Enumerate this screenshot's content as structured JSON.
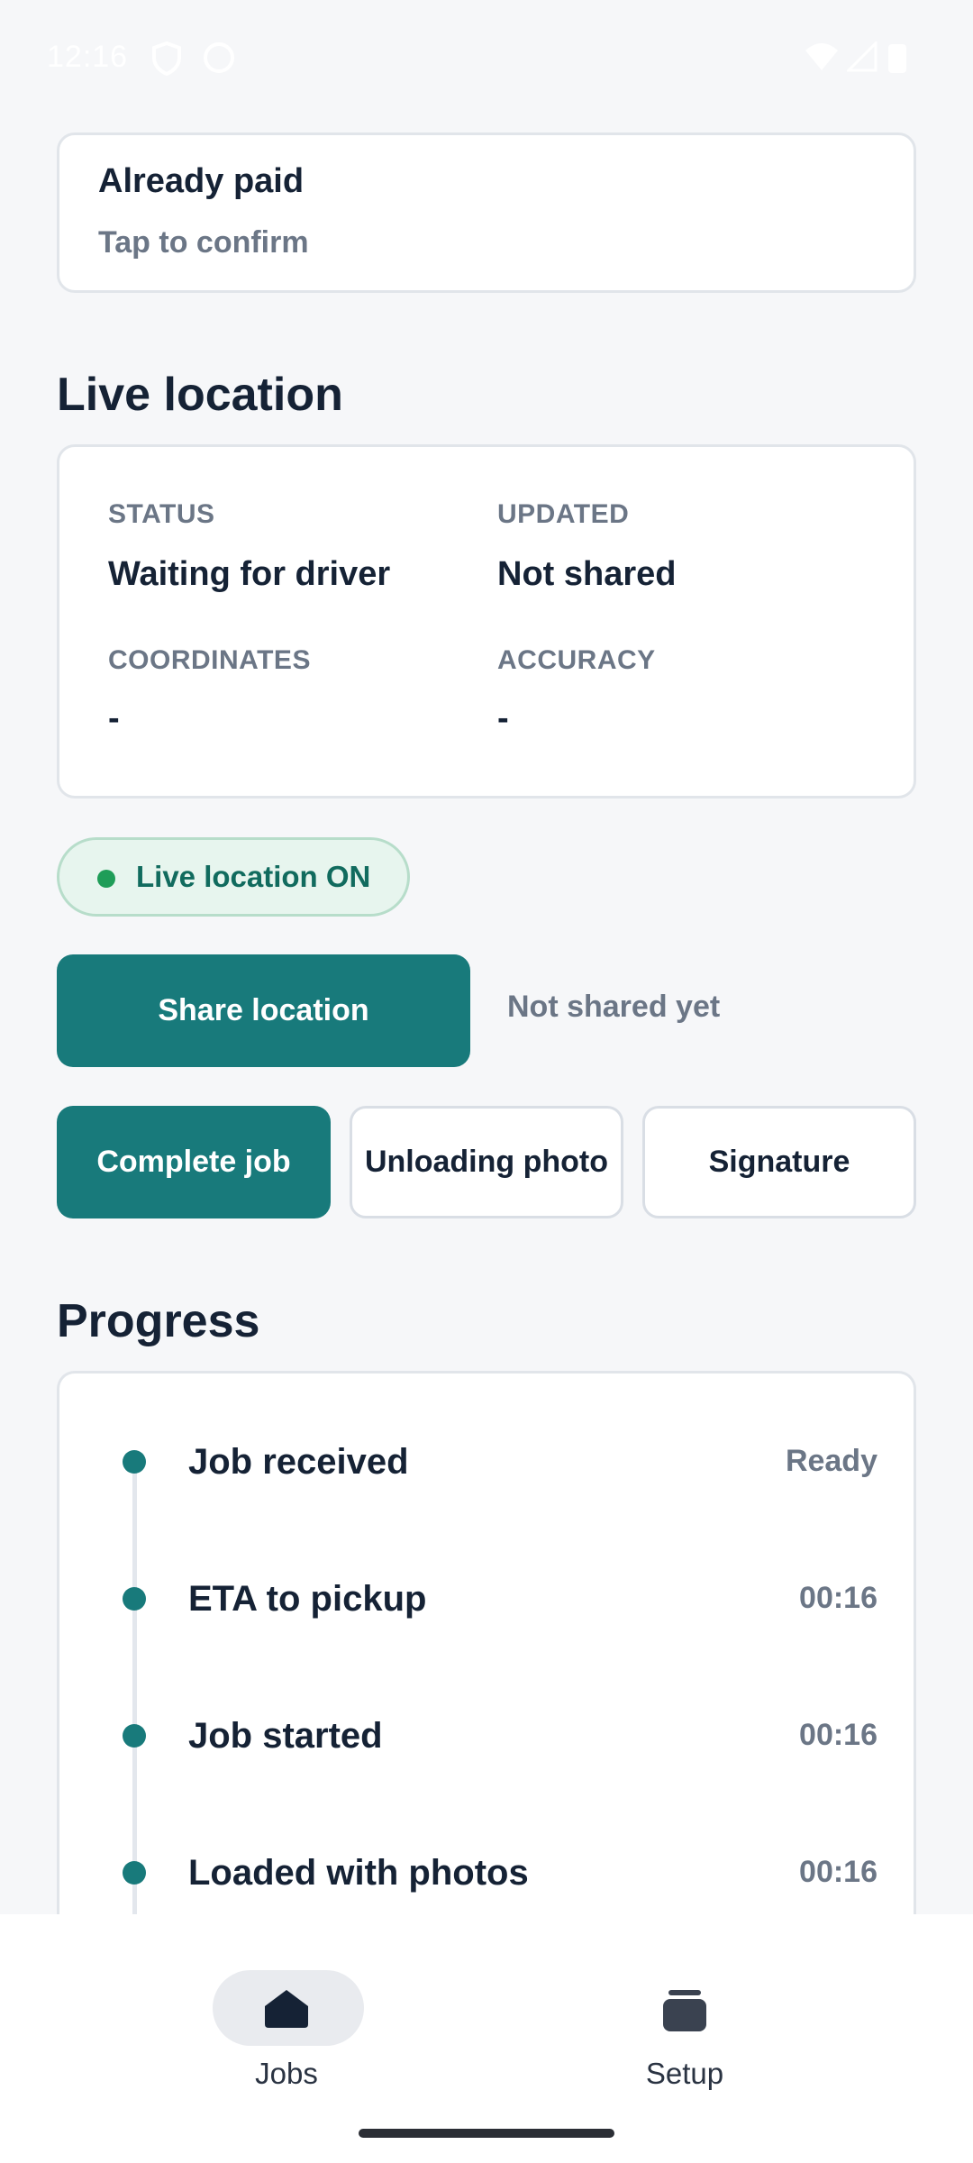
{
  "status_bar": {
    "time": "12:16"
  },
  "payment": {
    "title": "Already paid",
    "subtitle": "Tap to confirm"
  },
  "live_location": {
    "heading": "Live location",
    "status_label": "STATUS",
    "status_value": "Waiting for driver",
    "updated_label": "UPDATED",
    "updated_value": "Not shared",
    "coordinates_label": "COORDINATES",
    "coordinates_value": "-",
    "accuracy_label": "ACCURACY",
    "accuracy_value": "-",
    "pill_label": "Live location ON",
    "share_button": "Share location",
    "share_note": "Not shared yet"
  },
  "actions": {
    "complete": "Complete job",
    "unloading_photo": "Unloading photo",
    "signature": "Signature"
  },
  "progress": {
    "heading": "Progress",
    "steps": [
      {
        "label": "Job received",
        "meta": "Ready"
      },
      {
        "label": "ETA to pickup",
        "meta": "00:16"
      },
      {
        "label": "Job started",
        "meta": "00:16"
      },
      {
        "label": "Loaded with photos",
        "meta": "00:16"
      }
    ]
  },
  "nav": {
    "items": [
      {
        "label": "Jobs",
        "icon": "jobs-icon",
        "active": true
      },
      {
        "label": "Setup",
        "icon": "setup-icon",
        "active": false
      }
    ]
  },
  "colors": {
    "accent": "#187a7b",
    "live_dot": "#1f9d58",
    "text": "#152235",
    "muted": "#6b7686"
  }
}
